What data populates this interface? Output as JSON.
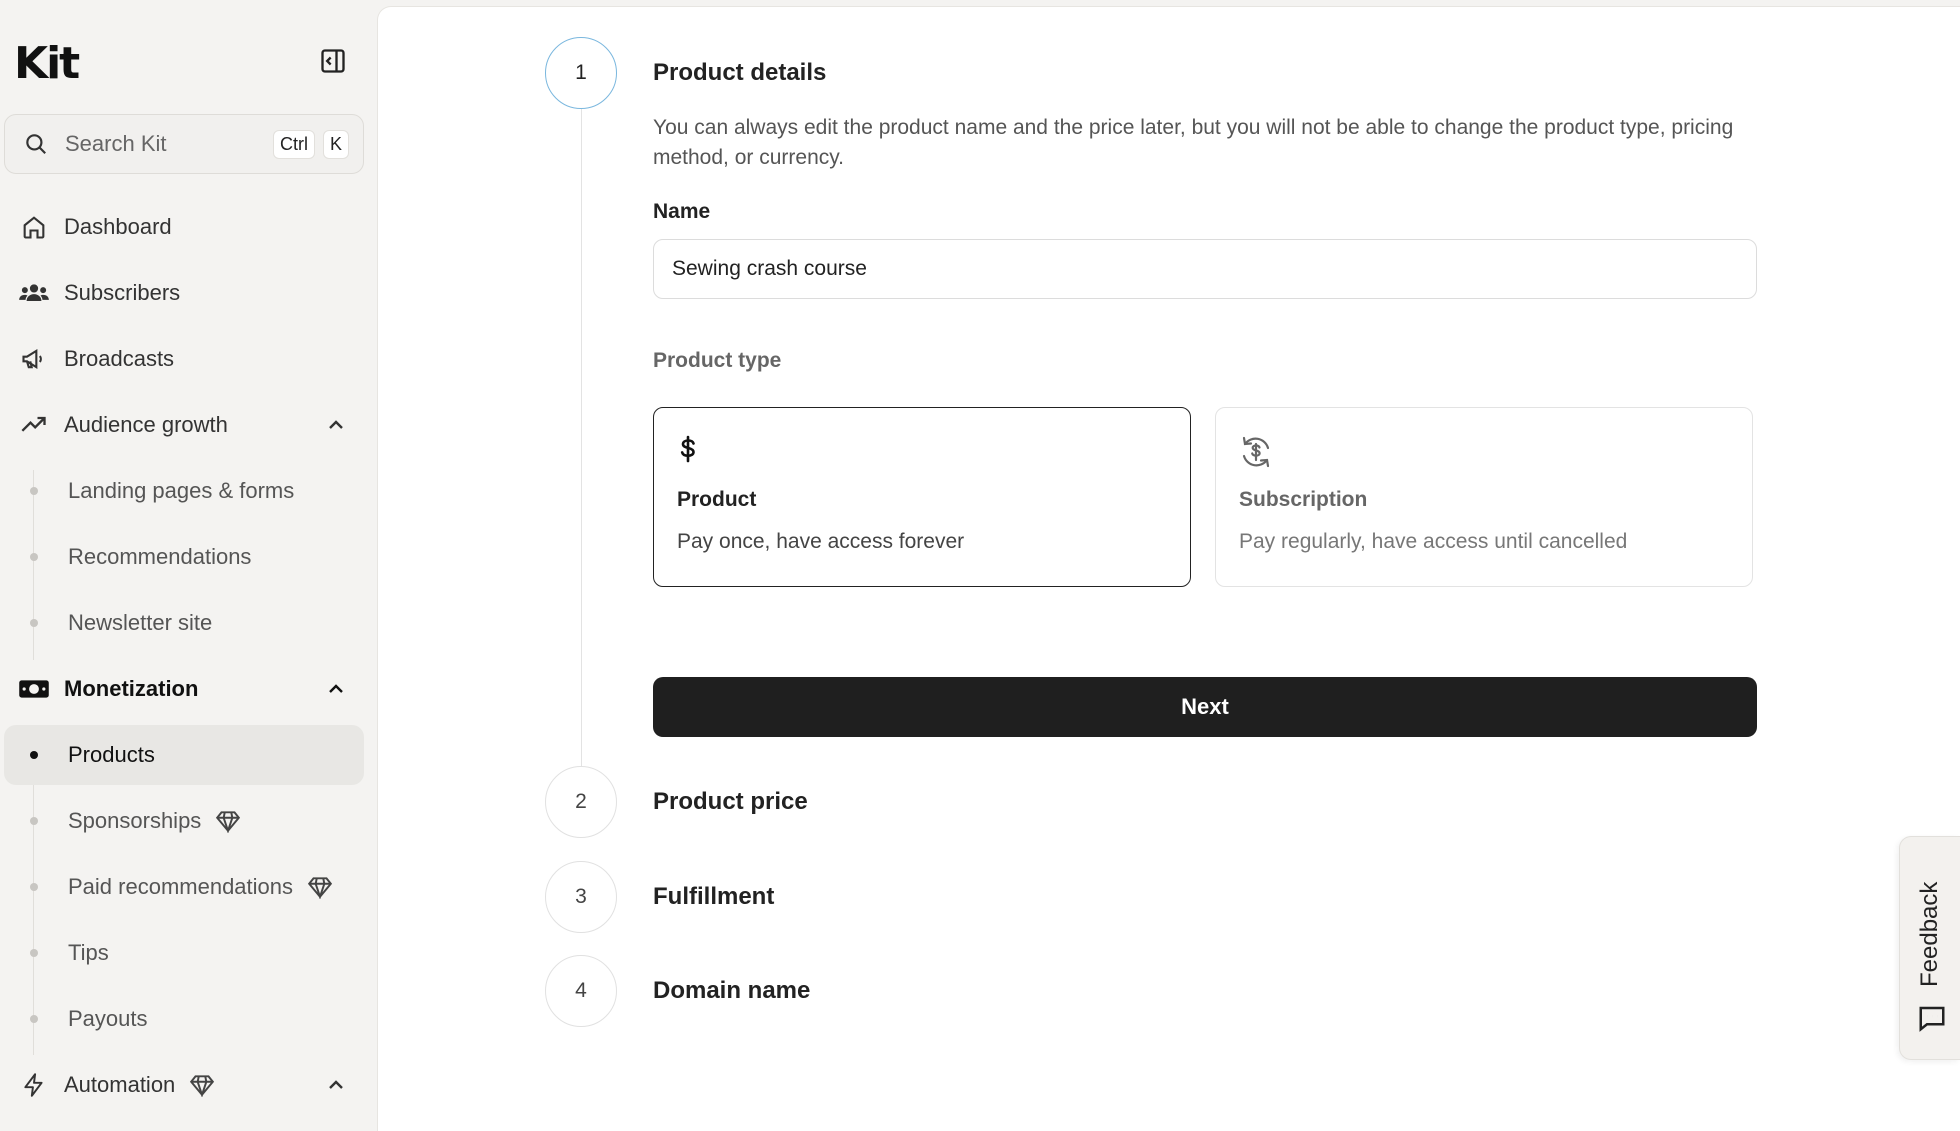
{
  "sidebar": {
    "logo": "Kit",
    "search": {
      "placeholder": "Search Kit",
      "kbd_ctrl": "Ctrl",
      "kbd_k": "K"
    },
    "nav": {
      "dashboard": "Dashboard",
      "subscribers": "Subscribers",
      "broadcasts": "Broadcasts",
      "audience_growth": "Audience growth",
      "landing_pages": "Landing pages & forms",
      "recommendations": "Recommendations",
      "newsletter_site": "Newsletter site",
      "monetization": "Monetization",
      "products": "Products",
      "sponsorships": "Sponsorships",
      "paid_recommendations": "Paid recommendations",
      "tips": "Tips",
      "payouts": "Payouts",
      "automation": "Automation"
    },
    "active_item": "Products"
  },
  "steps": [
    {
      "number": "1",
      "title": "Product details"
    },
    {
      "number": "2",
      "title": "Product price"
    },
    {
      "number": "3",
      "title": "Fulfillment"
    },
    {
      "number": "4",
      "title": "Domain name"
    }
  ],
  "product_details": {
    "description": "You can always edit the product name and the price later, but you will not be able to change the product type, pricing method, or currency.",
    "name_label": "Name",
    "name_value": "Sewing crash course",
    "type_label": "Product type",
    "types": [
      {
        "title": "Product",
        "subtitle": "Pay once, have access forever",
        "icon": "dollar-icon",
        "selected": true
      },
      {
        "title": "Subscription",
        "subtitle": "Pay regularly, have access until cancelled",
        "icon": "recurring-dollar-icon",
        "selected": false
      }
    ],
    "next_label": "Next"
  },
  "feedback": {
    "label": "Feedback"
  },
  "colors": {
    "accent_step": "#7ab7de",
    "button_bg": "#1f1f1f",
    "sidebar_bg": "#f4f3f1"
  }
}
